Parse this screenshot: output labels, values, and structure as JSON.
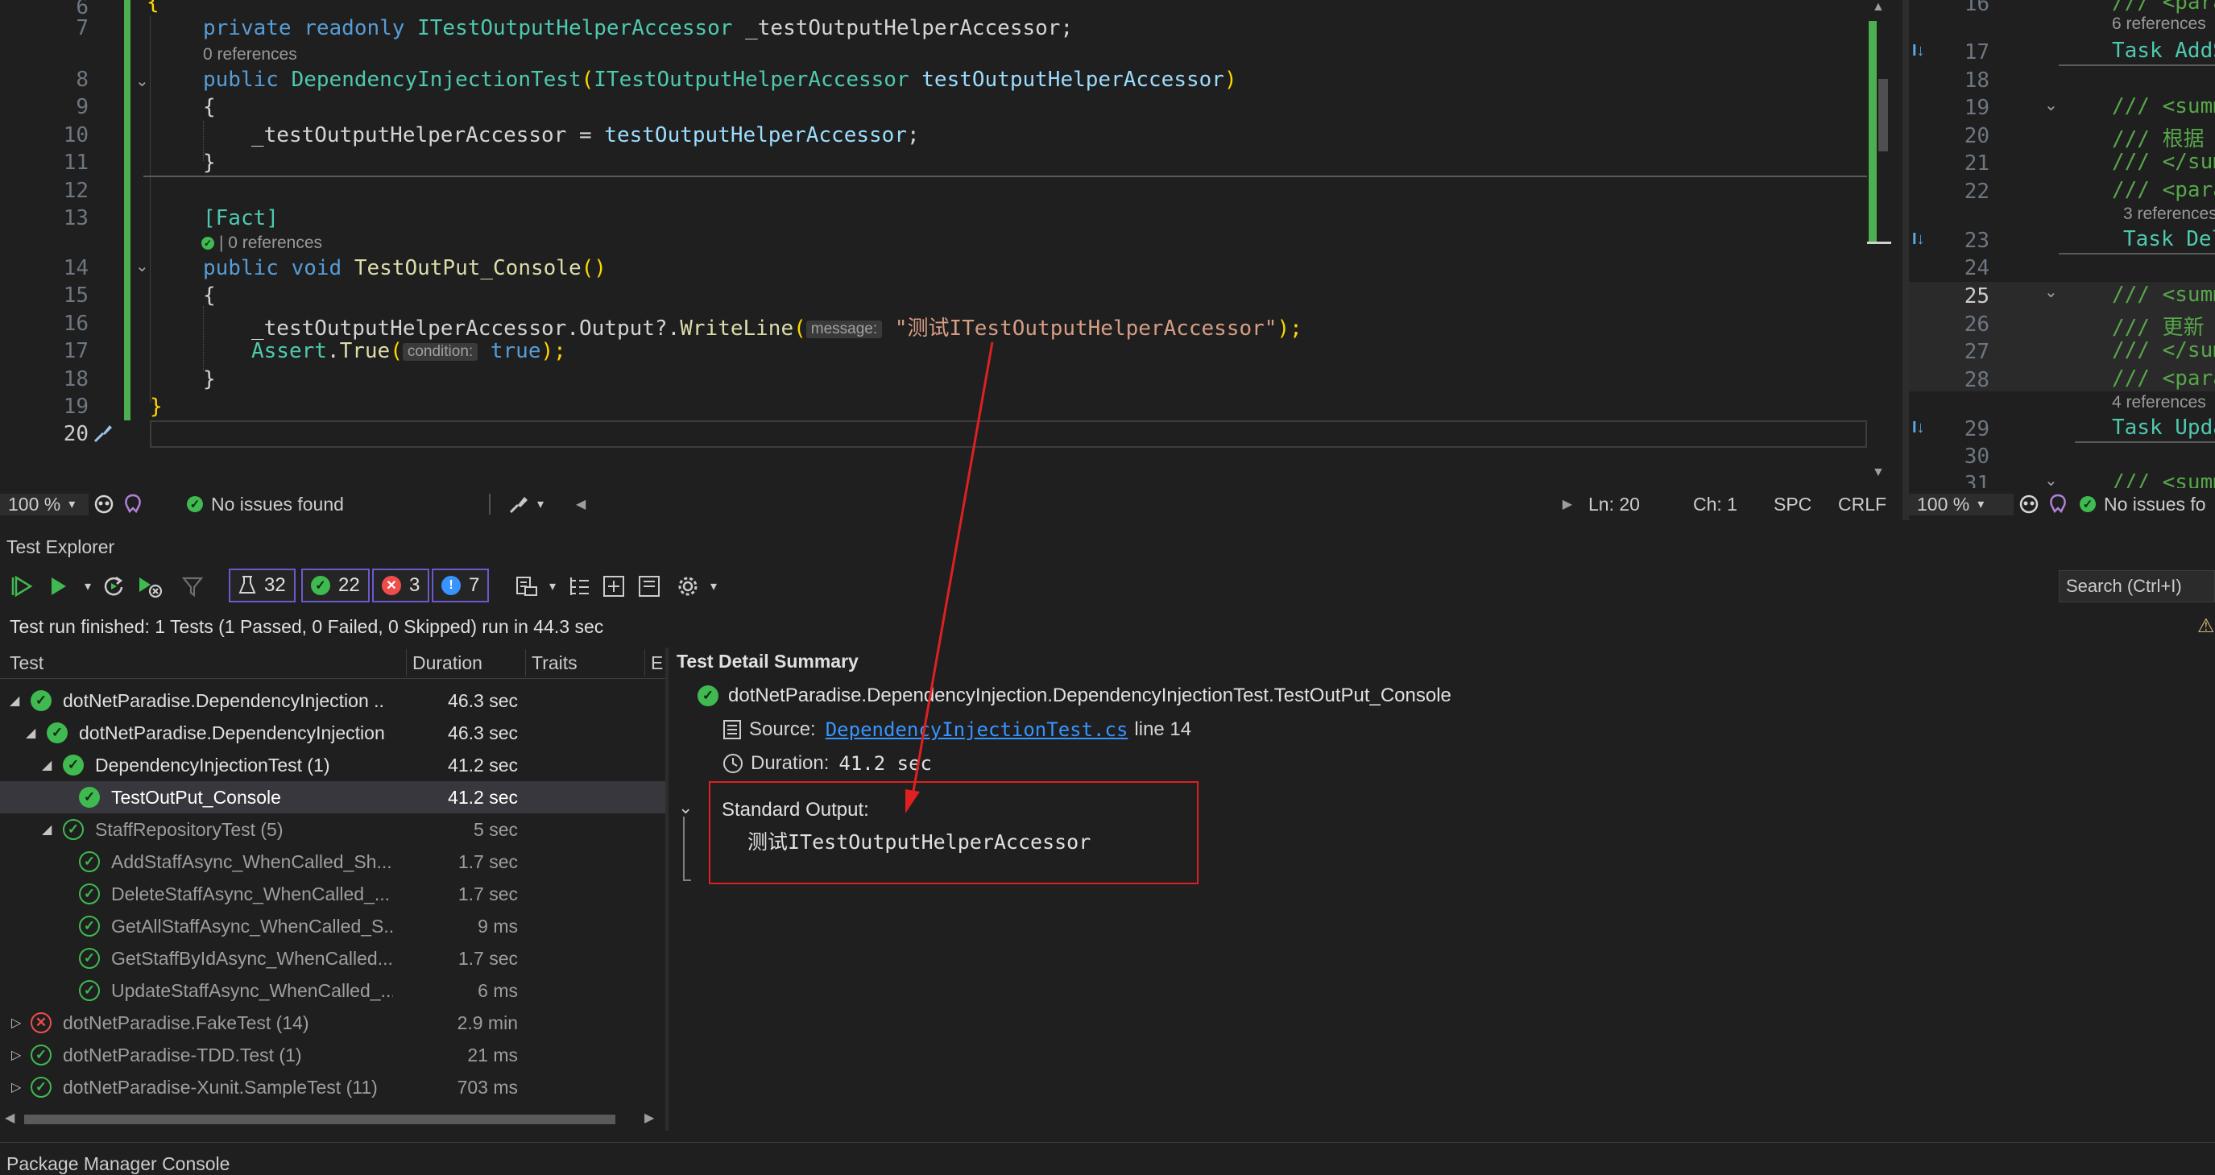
{
  "editor": {
    "lines": [
      {
        "num": "6"
      },
      {
        "num": "7"
      },
      {
        "num": "8"
      },
      {
        "num": "9"
      },
      {
        "num": "10"
      },
      {
        "num": "11"
      },
      {
        "num": "12"
      },
      {
        "num": "13"
      },
      {
        "num": "14"
      },
      {
        "num": "15"
      },
      {
        "num": "16"
      },
      {
        "num": "17"
      },
      {
        "num": "18"
      },
      {
        "num": "19"
      },
      {
        "num": "20"
      }
    ],
    "codelens_refs_7": "0 references",
    "codelens_refs_13": "| 0 references",
    "code": {
      "l7_kw": "private readonly ",
      "l7_type": "ITestOutputHelperAccessor",
      "l7_field": " _testOutputHelperAccessor;",
      "l8_kw": "public ",
      "l8_ctor": "DependencyInjectionTest",
      "l8_paren_open": "(",
      "l8_type": "ITestOutputHelperAccessor",
      "l8_param": " testOutputHelperAccessor",
      "l8_paren_close": ")",
      "l9": "{",
      "l10_field": "_testOutputHelperAccessor = ",
      "l10_param": "testOutputHelperAccessor",
      "l10_end": ";",
      "l11": "}",
      "l13_attr": "[Fact]",
      "l14_kw": "public void ",
      "l14_method": "TestOutPut_Console",
      "l14_end": "()",
      "l15": "{",
      "l16_field": "_testOutputHelperAccessor.",
      "l16_prop": "Output",
      "l16_mid": "?.",
      "l16_method": "WriteLine",
      "l16_open": "(",
      "l16_hint": "message:",
      "l16_str": "\"测试ITestOutputHelperAccessor\"",
      "l16_end": ");",
      "l17_type": "Assert",
      "l17_dot": ".",
      "l17_method": "True",
      "l17_open": "(",
      "l17_hint": "condition:",
      "l17_kw": " true",
      "l17_end": ");",
      "l18": "}",
      "l19": "}"
    },
    "status": {
      "zoom": "100 %",
      "issues": "No issues found",
      "ln": "Ln: 20",
      "ch": "Ch: 1",
      "spc": "SPC",
      "crlf": "CRLF"
    }
  },
  "editor_right": {
    "lines": [
      "16",
      "17",
      "18",
      "19",
      "20",
      "21",
      "22",
      "23",
      "24",
      "25",
      "26",
      "27",
      "28",
      "29",
      "30",
      "31"
    ],
    "refs_6": "6 references",
    "refs_3": "3 references",
    "refs_4": "4 references",
    "l16": "/// <para",
    "l17": "Task AddS",
    "l19": "/// <summ",
    "l20": "/// 根据",
    "l21": "/// </sum",
    "l22": "/// <para",
    "l23": "Task Del",
    "l25": "/// <summ",
    "l26": "/// 更新",
    "l27": "/// </sum",
    "l28": "/// <para",
    "l29": "Task Upda",
    "l31": "/// <summ",
    "zoom": "100 %",
    "issues": "No issues fo"
  },
  "test_explorer": {
    "title": "Test Explorer",
    "counts": {
      "total": "32",
      "passed": "22",
      "failed": "3",
      "info": "7"
    },
    "search_placeholder": "Search (Ctrl+I)",
    "run_summary": "Test run finished: 1 Tests (1 Passed, 0 Failed, 0 Skipped) run in 44.3 sec",
    "columns": {
      "test": "Test",
      "duration": "Duration",
      "traits": "Traits",
      "e": "E"
    },
    "rows": [
      {
        "name": "dotNetParadise.DependencyInjection ..",
        "duration": "46.3 sec"
      },
      {
        "name": "dotNetParadise.DependencyInjection",
        "duration": "46.3 sec"
      },
      {
        "name": "DependencyInjectionTest (1)",
        "duration": "41.2 sec"
      },
      {
        "name": "TestOutPut_Console",
        "duration": "41.2 sec"
      },
      {
        "name": "StaffRepositoryTest (5)",
        "duration": "5 sec"
      },
      {
        "name": "AddStaffAsync_WhenCalled_Sh...",
        "duration": "1.7 sec"
      },
      {
        "name": "DeleteStaffAsync_WhenCalled_...",
        "duration": "1.7 sec"
      },
      {
        "name": "GetAllStaffAsync_WhenCalled_S...",
        "duration": "9 ms"
      },
      {
        "name": "GetStaffByIdAsync_WhenCalled...",
        "duration": "1.7 sec"
      },
      {
        "name": "UpdateStaffAsync_WhenCalled_...",
        "duration": "6 ms"
      },
      {
        "name": "dotNetParadise.FakeTest (14)",
        "duration": "2.9 min"
      },
      {
        "name": "dotNetParadise-TDD.Test (1)",
        "duration": "21 ms"
      },
      {
        "name": "dotNetParadise-Xunit.SampleTest (11)",
        "duration": "703 ms"
      }
    ],
    "detail": {
      "title": "Test Detail Summary",
      "test_full_name": "dotNetParadise.DependencyInjection.DependencyInjectionTest.TestOutPut_Console",
      "source_label": "Source:",
      "source_file": "DependencyInjectionTest.cs",
      "source_line": "line 14",
      "duration_label": "Duration:",
      "duration_value": "41.2 sec",
      "std_output_label": "Standard Output:",
      "std_output_value": "测试ITestOutputHelperAccessor"
    }
  },
  "bottom_tab": "Package Manager Console",
  "colors": {
    "bg": "#1f1f1f",
    "pass": "#3fb950",
    "fail": "#f14c4c",
    "highlight_box": "#e02020",
    "link": "#3794ff",
    "change_bar": "#4caf50"
  }
}
